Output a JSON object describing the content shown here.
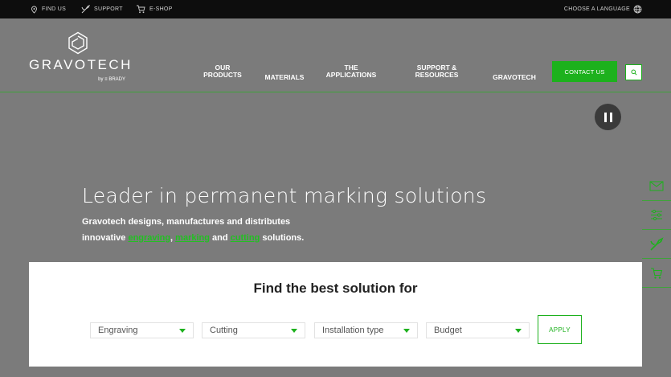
{
  "topbar": {
    "find_us": "FIND US",
    "support": "SUPPORT",
    "eshop": "E-SHOP",
    "language": "CHOOSE A LANGUAGE"
  },
  "logo": {
    "wordmark": "GRAVOTECH",
    "byline": "by ≡ BRADY"
  },
  "nav": {
    "products": [
      "OUR",
      "PRODUCTS"
    ],
    "materials": "MATERIALS",
    "applications": [
      "THE",
      "APPLICATIONS"
    ],
    "support": [
      "SUPPORT &",
      "RESOURCES"
    ],
    "gravotech": "GRAVOTECH",
    "contact": "CONTACT US"
  },
  "hero": {
    "title": "Leader in permanent marking solutions",
    "line1": "Gravotech designs, manufactures and distributes",
    "line2_prefix": "innovative ",
    "link_engraving": "engraving",
    "sep1": ", ",
    "link_marking": "marking",
    "sep2": " and ",
    "link_cutting": "cutting",
    "line2_suffix": " solutions."
  },
  "finder": {
    "title": "Find the best solution for",
    "selects": [
      "Engraving",
      "Cutting",
      "Installation type",
      "Budget"
    ],
    "apply": "APPLY"
  },
  "colors": {
    "accent": "#1db11d",
    "topbar_bg": "#0d0d0d",
    "overlay_bg": "#7b7b7b"
  },
  "icons": {
    "topbar": [
      "location-pin-icon",
      "wrench-icon",
      "cart-icon",
      "globe-icon"
    ],
    "side": [
      "mail-icon",
      "sliders-icon",
      "wrench-icon",
      "cart-icon"
    ],
    "controls": [
      "search-icon",
      "pause-icon"
    ]
  }
}
